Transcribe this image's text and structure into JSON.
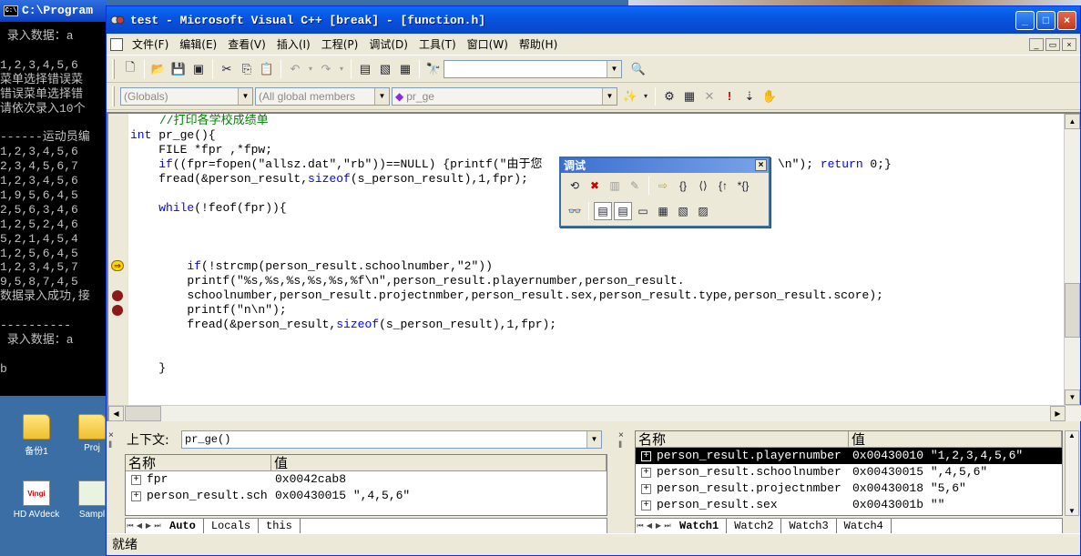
{
  "console": {
    "title": "C:\\Program",
    "lines": [
      " 录入数据：a",
      "",
      "1,2,3,4,5,6",
      "菜单选择错误菜",
      "错误菜单选择错",
      "请依次录入10个",
      "",
      "------运动员编",
      "1,2,3,4,5,6",
      "2,3,4,5,6,7",
      "1,2,3,4,5,6",
      "1,9,5,6,4,5",
      "2,5,6,3,4,6",
      "1,2,5,2,4,6",
      "5,2,1,4,5,4",
      "1,2,5,6,4,5",
      "1,2,3,4,5,7",
      "9,5,8,7,4,5",
      "数据录入成功,接",
      "",
      "----------",
      " 录入数据：a",
      "",
      "b"
    ]
  },
  "desktop": {
    "icons": [
      {
        "label": "备份1"
      },
      {
        "label": "Proj"
      },
      {
        "label": "HD AVdeck",
        "badge": "Vingi"
      },
      {
        "label": "Sampl"
      }
    ]
  },
  "window": {
    "title": "test - Microsoft Visual C++ [break] - [function.h]",
    "caption_buttons": {
      "minimize": "_",
      "maximize": "□",
      "close": "×"
    }
  },
  "menu": {
    "items": [
      "文件(F)",
      "编辑(E)",
      "查看(V)",
      "插入(I)",
      "工程(P)",
      "调试(D)",
      "工具(T)",
      "窗口(W)",
      "帮助(H)"
    ]
  },
  "wizardbar": {
    "class_combo": "(Globals)",
    "filter_combo": "(All global members",
    "member_combo": "pr_ge"
  },
  "editor": {
    "comment_line": "//打印各学校成绩单",
    "kw_int": "int",
    "func_decl": " pr_ge(){",
    "line_file": "    FILE *fpr ,*fpw;",
    "kw_if": "if",
    "line_fopen": "((fpr=fopen(\"allsz.dat\",\"rb\"))==NULL) {printf(\"由于您",
    "line_fopen_tail": "\\n\"); ",
    "kw_return": "return",
    "line_return_tail": " 0;}",
    "line_fread1a": "    fread(&person_result,",
    "kw_sizeof": "sizeof",
    "line_fread1b": "(s_person_result),1,fpr);",
    "kw_while": "while",
    "line_while": "(!feof(fpr)){",
    "kw_if2": "if",
    "line_strcmp": "(!strcmp(person_result.schoolnumber,\"2\"))",
    "line_printf1": "        printf(\"%s,%s,%s,%s,%s,%f\\n\",person_result.playernumber,person_result.",
    "line_args": "        schoolnumber,person_result.projectnmber,person_result.sex,person_result.type,person_result.score);",
    "line_printf2": "        printf(\"n\\n\");",
    "line_fread2a": "        fread(&person_result,",
    "kw_sizeof2": "sizeof",
    "line_fread2b": "(s_person_result),1,fpr);",
    "line_close": "    }"
  },
  "debug_toolbar": {
    "title": "调试"
  },
  "variables_panel": {
    "context_label": "上下文:",
    "context_value": "pr_ge()",
    "columns": [
      "名称",
      "值"
    ],
    "rows": [
      {
        "name": "fpr",
        "value": "0x0042cab8"
      },
      {
        "name": "person_result.sch",
        "value": "0x00430015 \",4,5,6\""
      }
    ],
    "tabs": [
      "Auto",
      "Locals",
      "this"
    ]
  },
  "watch_panel": {
    "columns": [
      "名称",
      "值"
    ],
    "rows": [
      {
        "name": "person_result.playernumber",
        "value": "0x00430010 \"1,2,3,4,5,6\""
      },
      {
        "name": "person_result.schoolnumber",
        "value": "0x00430015 \",4,5,6\""
      },
      {
        "name": "person_result.projectnmber",
        "value": "0x00430018 \"5,6\""
      },
      {
        "name": "person_result.sex",
        "value": "0x0043001b \"\""
      }
    ],
    "tabs": [
      "Watch1",
      "Watch2",
      "Watch3",
      "Watch4"
    ]
  },
  "status": {
    "text": "就绪"
  }
}
